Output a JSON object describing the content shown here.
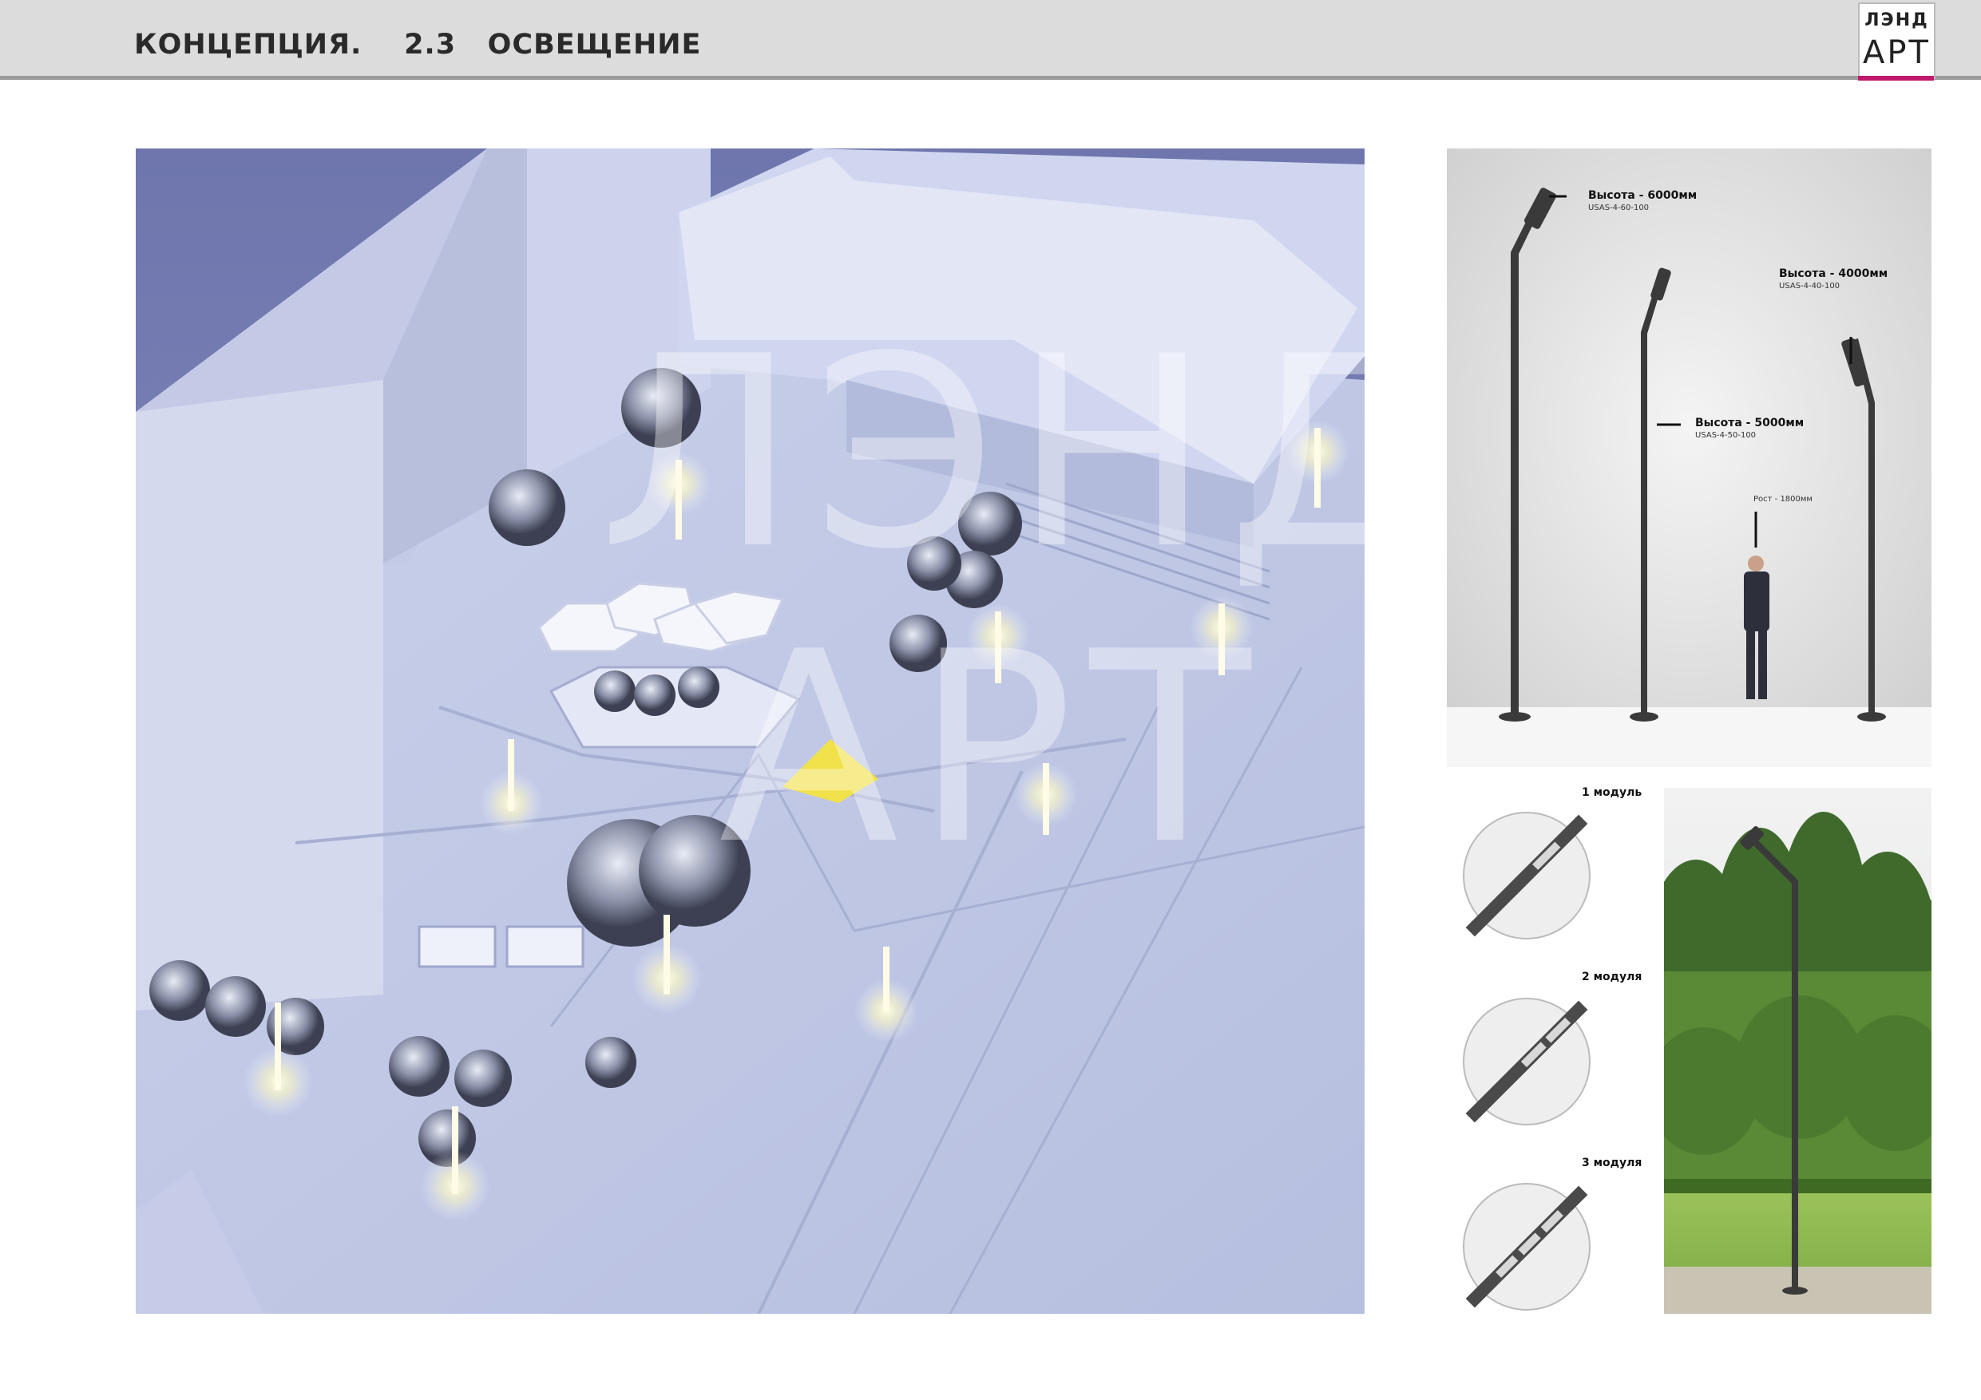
{
  "header": {
    "title": "КОНЦЕПЦИЯ.    2.3   ОСВЕЩЕНИЕ",
    "logo_top": "ЛЭНД",
    "logo_bottom": "АРТ",
    "accent_color": "#c0186c"
  },
  "render": {
    "watermark_top": "ЛЭНД",
    "watermark_bottom": "АРТ"
  },
  "poles": [
    {
      "height_label": "Высота - 6000мм",
      "code": "USAS-4-60-100"
    },
    {
      "height_label": "Высота - 5000мм",
      "code": "USAS-4-50-100"
    },
    {
      "height_label": "Высота - 4000мм",
      "code": "USAS-4-40-100"
    }
  ],
  "person_label": "Рост - 1800мм",
  "modules": [
    {
      "label": "1 модуль",
      "count": 1
    },
    {
      "label": "2 модуля",
      "count": 2
    },
    {
      "label": "3 модуля",
      "count": 3
    }
  ]
}
